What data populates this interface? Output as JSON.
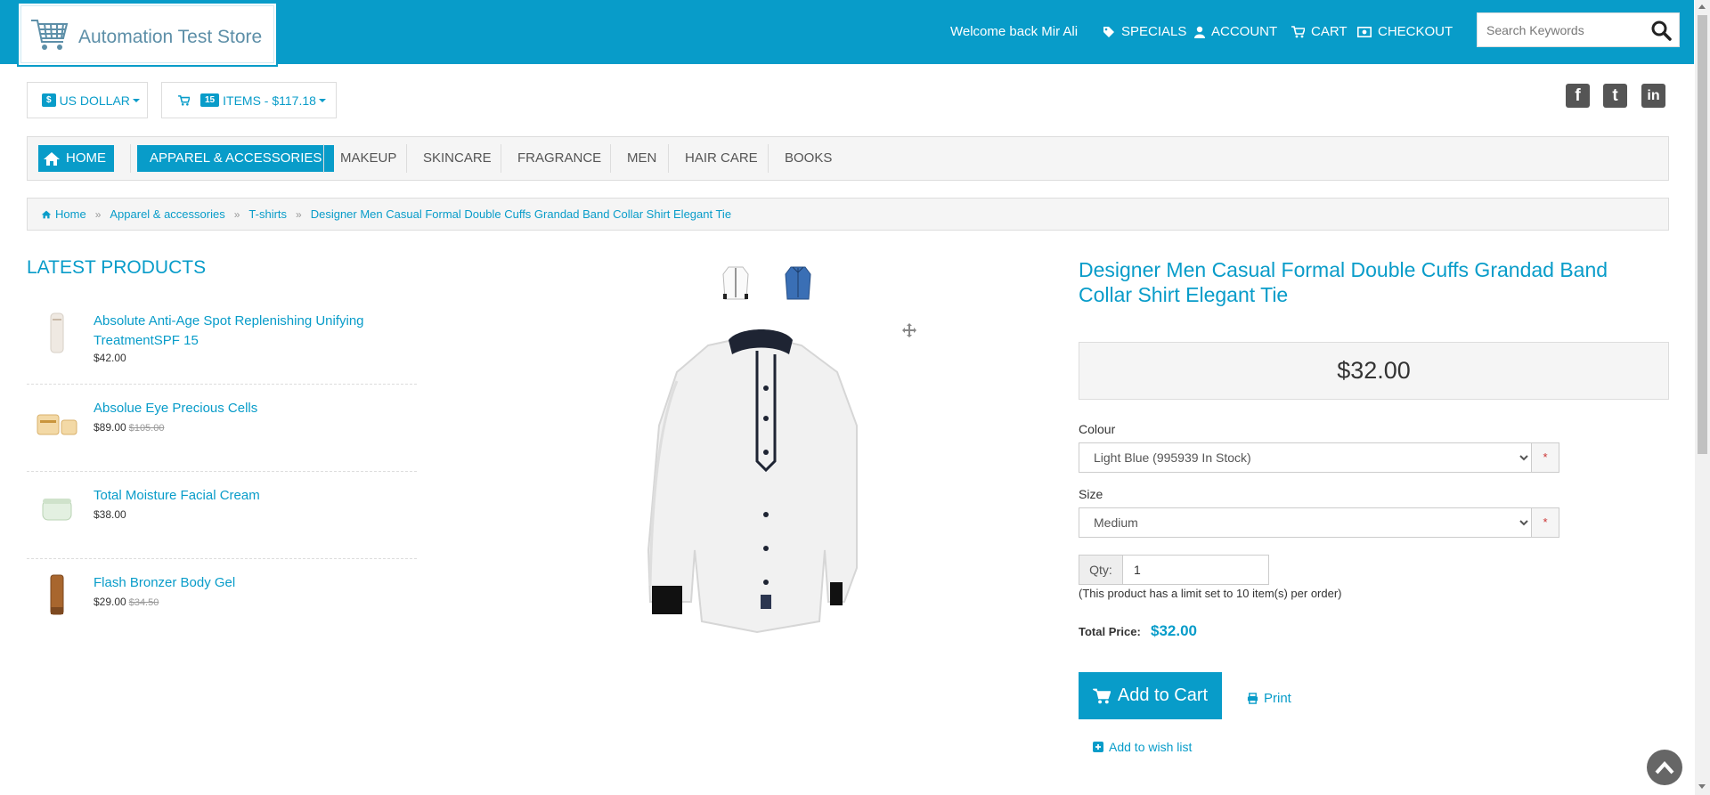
{
  "header": {
    "logo_text": "Automation Test Store",
    "welcome": "Welcome back Mir Ali",
    "nav": [
      {
        "label": "SPECIALS",
        "icon": "tag-icon"
      },
      {
        "label": "ACCOUNT",
        "icon": "user-icon"
      },
      {
        "label": "CART",
        "icon": "cart-icon"
      },
      {
        "label": "CHECKOUT",
        "icon": "money-icon"
      }
    ],
    "search_placeholder": "Search Keywords"
  },
  "currency": {
    "symbol": "$",
    "label": "US DOLLAR"
  },
  "cart_summary": {
    "count": "15",
    "label": "ITEMS - $117.18"
  },
  "social": [
    "facebook-icon",
    "twitter-icon",
    "linkedin-icon"
  ],
  "categories": [
    {
      "label": "HOME"
    },
    {
      "label": "APPAREL & ACCESSORIES"
    },
    {
      "label": "MAKEUP"
    },
    {
      "label": "SKINCARE"
    },
    {
      "label": "FRAGRANCE"
    },
    {
      "label": "MEN"
    },
    {
      "label": "HAIR CARE"
    },
    {
      "label": "BOOKS"
    }
  ],
  "breadcrumb": [
    "Home",
    "Apparel & accessories",
    "T-shirts",
    "Designer Men Casual Formal Double Cuffs Grandad Band Collar Shirt Elegant Tie"
  ],
  "latest": {
    "title": "LATEST PRODUCTS",
    "items": [
      {
        "name": "Absolute Anti-Age Spot Replenishing Unifying TreatmentSPF 15",
        "price": "$42.00",
        "old_price": ""
      },
      {
        "name": "Absolue Eye Precious Cells",
        "price": "$89.00",
        "old_price": "$105.00"
      },
      {
        "name": "Total Moisture Facial Cream",
        "price": "$38.00",
        "old_price": ""
      },
      {
        "name": "Flash Bronzer Body Gel",
        "price": "$29.00",
        "old_price": "$34.50"
      }
    ]
  },
  "product": {
    "title": "Designer Men Casual Formal Double Cuffs Grandad Band Collar Shirt Elegant Tie",
    "price": "$32.00",
    "colour_label": "Colour",
    "colour_value": "Light Blue (995939 In Stock)",
    "size_label": "Size",
    "size_value": "Medium",
    "required_mark": "*",
    "qty_label": "Qty:",
    "qty_value": "1",
    "limit_note": "(This product has a limit set to 10 item(s) per order)",
    "total_label": "Total Price:",
    "total_value": "$32.00",
    "add_to_cart": "Add to Cart",
    "print": "Print",
    "wishlist": "Add to wish list"
  },
  "colors": {
    "brand": "#089cc9",
    "bg_panel": "#f5f5f5"
  }
}
